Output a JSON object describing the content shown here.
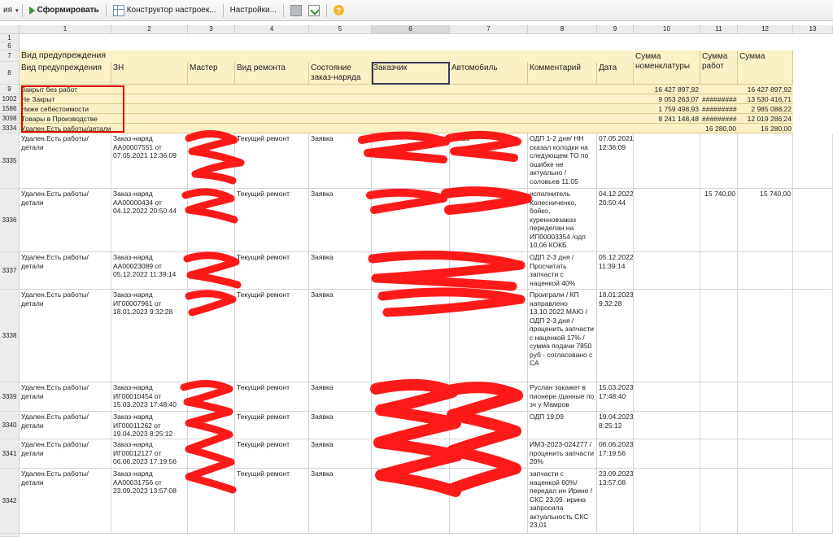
{
  "toolbar": {
    "menu_fragment": "ия",
    "generate_label": "Сформировать",
    "constructor_label": "Конструктор настроек...",
    "settings_label": "Настройки...",
    "help_label": "?"
  },
  "columns": [
    "1",
    "2",
    "3",
    "4",
    "5",
    "6",
    "7",
    "8",
    "9",
    "10",
    "11",
    "12",
    "13"
  ],
  "top_rows": [
    "1",
    "6",
    "7",
    "8"
  ],
  "header": {
    "group_title": "Вид предупреждения",
    "c1": "Вид предупреждения",
    "c2": "ЗН",
    "c3": "Мастер",
    "c4": "Вид ремонта",
    "c5": "Состояние заказ-наряда",
    "c6": "Заказчик",
    "c7": "Автомобиль",
    "c8": "Комментарий",
    "c9": "Дата",
    "c10": "Сумма номенклатуры",
    "c11": "Сумма работ",
    "c12": "Сумма"
  },
  "groups": [
    {
      "row": "9",
      "name": "Закрыт без работ",
      "c10": "16 427 897,92",
      "c11": "",
      "c12": "16 427 897,92"
    },
    {
      "row": "1002",
      "name": "Не Закрыт",
      "c10": "9 053 263,07",
      "c11": "#########",
      "c12": "13 530 416,71"
    },
    {
      "row": "1586",
      "name": "Ниже себестоимости",
      "c10": "1 759 498,93",
      "c11": "#########",
      "c12": "2 985 088,22"
    },
    {
      "row": "3098",
      "name": "Товары в Производстве",
      "c10": "8 241 148,48",
      "c11": "#########",
      "c12": "12 019 286,24"
    },
    {
      "row": "3334",
      "name": "Удален.Есть работы/детали",
      "c10": "",
      "c11": "16 280,00",
      "c12": "16 280,00"
    }
  ],
  "rows": [
    {
      "row": "3335",
      "c1": "Удален.Есть работы/детали",
      "c2": "Заказ-наряд АА00007551 от 07.05.2021 12:36:09",
      "c4": "Текущий ремонт",
      "c5": "Заявка",
      "c7": "Х 415",
      "c8": "ОДП 1-2 дня/ НН сказал колодки на следующем ТО по ошибке не актуально / соловьев 11.05",
      "c9": "07.05.2021 12:36:09",
      "c11": "",
      "c12": ""
    },
    {
      "row": "3336",
      "c1": "Удален.Есть работы/детали",
      "c2": "Заказ-наряд АА00000434 от 04.12.2022 20:50:44",
      "c4": "Текущий ремонт",
      "c5": "Заявка",
      "c7": "",
      "c8": "исполнитель Колесниченко, бойко, куренновзаказ переделан на ИП00003354 /одп 10,06 КОКБ",
      "c9": "04.12.2022 20:50:44",
      "c11": "15 740,00",
      "c12": "15 740,00"
    },
    {
      "row": "3337",
      "c1": "Удален.Есть работы/детали",
      "c2": "Заказ-наряд АА00023089 от 05.12.2022 11:39:14",
      "c4": "Текущий ремонт",
      "c5": "Заявка",
      "c7": "",
      "c8": "ОДП 2-3 дня /Просчитать запчасти с наценкой 40%",
      "c9": "05.12.2022 11:39:14",
      "c11": "",
      "c12": ""
    },
    {
      "row": "3338",
      "c1": "Удален.Есть работы/детали",
      "c2": "Заказ-наряд ИГ00007961 от 18.01.2023 9:32:28",
      "c4": "Текущий ремонт",
      "c5": "Заявка",
      "c7": "",
      "c8": "Проиграли / КП направлено 13.10.2022 МАЮ / ОДП 2-3 дня / проценить запчасти с наценкой 17% / сумма подачи 7850 руб - согласовано с СА",
      "c9": "18.01.2023 9:32:28",
      "c11": "",
      "c12": ""
    },
    {
      "row": "3339",
      "c1": "Удален.Есть работы/детали",
      "c2": "Заказ-наряд ИГ00010454 от 15.03.2023 17:48:40",
      "c4": "Текущий ремонт",
      "c5": "Заявка",
      "c7": "",
      "c8": "Руслан закажет в пионере /данные по зч у Мамров",
      "c9": "15.03.2023 17:48:40",
      "c11": "",
      "c12": ""
    },
    {
      "row": "3340",
      "c1": "Удален.Есть работы/детали",
      "c2": "Заказ-наряд ИГ00011262 от 19.04.2023 8:25:12",
      "c4": "Текущий ремонт",
      "c5": "Заявка",
      "c7": "",
      "c8": "ОДП 19,09",
      "c9": "19.04.2023 8:25:12",
      "c11": "",
      "c12": ""
    },
    {
      "row": "3341",
      "c1": "Удален.Есть работы/детали",
      "c2": "Заказ-наряд ИГ00012127 от 06.06.2023 17:19:56",
      "c4": "Текущий ремонт",
      "c5": "Заявка",
      "c7": "",
      "c8": "ИМЗ-2023-024277 / проценить запчасти 20%",
      "c9": "06.06.2023 17:19:56",
      "c11": "",
      "c12": ""
    },
    {
      "row": "3342",
      "c1": "Удален.Есть работы/детали",
      "c2": "Заказ-наряд АА00031756 от 23.09.2023 13:57:08",
      "c4": "Текущий ремонт",
      "c5": "Заявка",
      "c7": "",
      "c8": "запчасти с наценкой 60%/ передал ин Ирине /СКС 23,09. ирина запросила актуальность СКС 23,01",
      "c9": "23.09.2023 13:57:08",
      "c11": "",
      "c12": ""
    }
  ],
  "colors": {
    "header_bg": "#fbf1c7",
    "highlight_box": "#e00000",
    "scribble": "#ff1a1a"
  }
}
